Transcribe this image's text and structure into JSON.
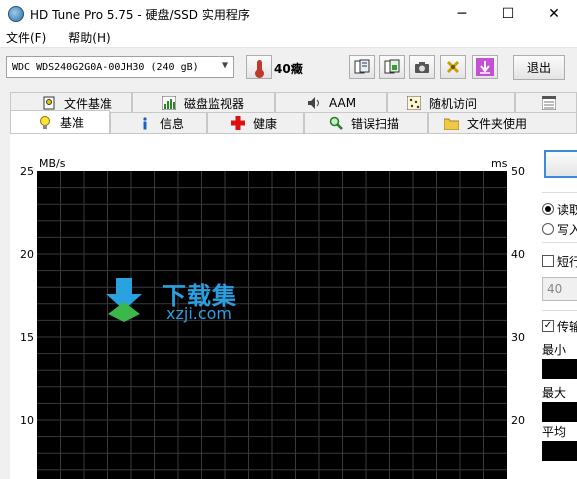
{
  "window": {
    "title": "HD Tune Pro 5.75 - 硬盘/SSD 实用程序",
    "controls": {
      "minimize": "─",
      "maximize": "☐",
      "close": "✕"
    }
  },
  "menu": {
    "file": "文件(F)",
    "help": "帮助(H)"
  },
  "toolbar": {
    "drive": "WDC WDS240G2G0A-00JH30 (240 gB)",
    "temperature": "40癥",
    "exit": "退出"
  },
  "tabs_row1": [
    {
      "label": "文件基准",
      "icon": "file-benchmark-icon"
    },
    {
      "label": "磁盘监视器",
      "icon": "disk-monitor-icon"
    },
    {
      "label": "AAM",
      "icon": "speaker-icon"
    },
    {
      "label": "随机访问",
      "icon": "random-access-icon"
    },
    {
      "label": "",
      "icon": "extra-tests-icon"
    }
  ],
  "tabs_row2": [
    {
      "label": "基准",
      "icon": "lightbulb-icon",
      "active": true
    },
    {
      "label": "信息",
      "icon": "info-icon"
    },
    {
      "label": "健康",
      "icon": "health-cross-icon"
    },
    {
      "label": "错误扫描",
      "icon": "magnifier-icon"
    },
    {
      "label": "文件夹使用",
      "icon": "folder-icon"
    }
  ],
  "chart_data": {
    "type": "line",
    "left_axis": {
      "unit": "MB/s",
      "ticks": [
        25,
        20,
        15,
        10
      ],
      "range": [
        0,
        25
      ]
    },
    "right_axis": {
      "unit": "ms",
      "ticks": [
        50,
        40,
        30,
        20
      ],
      "range": [
        0,
        50
      ]
    },
    "series": [],
    "grid": true,
    "background": "#000000",
    "grid_color": "#3a3a3a"
  },
  "watermark": {
    "title": "下载集",
    "subtitle": "xzji.com"
  },
  "side": {
    "read": "读取",
    "write": "写入",
    "short_stroke": "短行",
    "short_stroke_value": "40",
    "transfer": "传输",
    "min": "最小",
    "max": "最大",
    "avg": "平均"
  }
}
